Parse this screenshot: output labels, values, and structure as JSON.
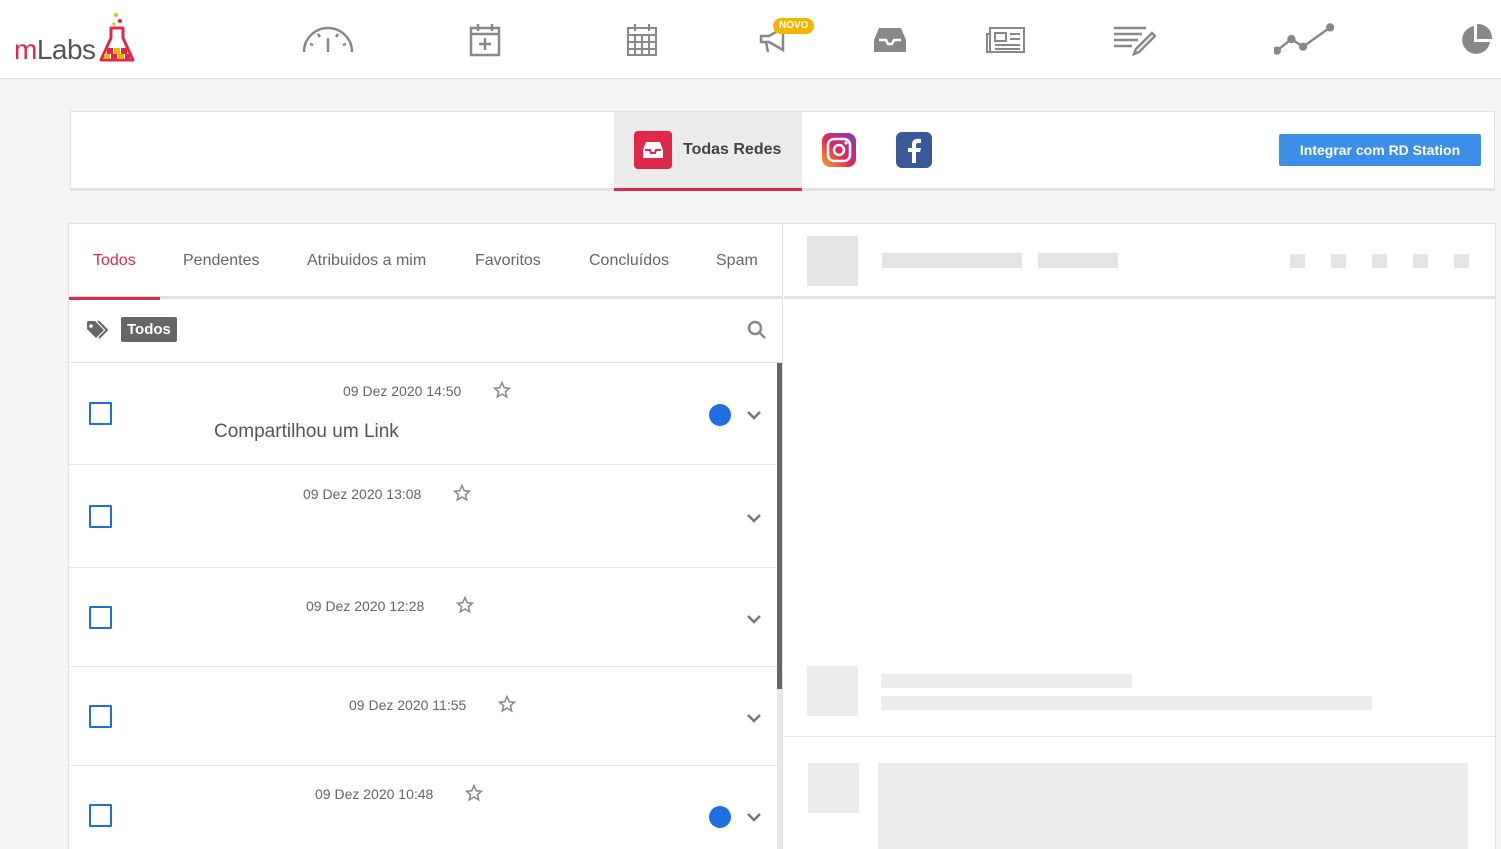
{
  "brand": {
    "logo_text_m": "m",
    "logo_text_rest": "Labs"
  },
  "topnav": {
    "icons": [
      "dashboard-gauge-icon",
      "calendar-add-icon",
      "calendar-icon",
      "megaphone-icon",
      "inbox-icon",
      "newspaper-icon",
      "report-edit-icon",
      "line-chart-icon",
      "pie-chart-icon"
    ],
    "badge": "NOVO"
  },
  "networks": {
    "all_label": "Todas Redes",
    "integrate_button": "Integrar com RD Station"
  },
  "tabs": [
    "Todos",
    "Pendentes",
    "Atribuidos a mim",
    "Favoritos",
    "Concluídos",
    "Spam"
  ],
  "active_tab": "Todos",
  "filter": {
    "chip": "Todos"
  },
  "messages": [
    {
      "date": "09 Dez 2020 14:50",
      "text": "Compartilhou um Link",
      "unread": true
    },
    {
      "date": "09 Dez 2020 13:08",
      "text": "",
      "unread": false
    },
    {
      "date": "09 Dez 2020 12:28",
      "text": "",
      "unread": false
    },
    {
      "date": "09 Dez 2020 11:55",
      "text": "",
      "unread": false
    },
    {
      "date": "09 Dez 2020 10:48",
      "text": "",
      "unread": true
    }
  ],
  "colors": {
    "accent": "#e0284a",
    "primary_button": "#3d8ee6",
    "checkbox": "#1e70d8",
    "unread_dot": "#1e6fe0",
    "badge": "#f5b400"
  }
}
